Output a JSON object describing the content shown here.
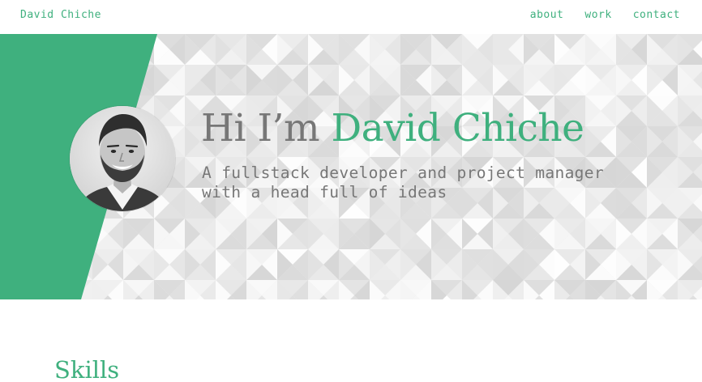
{
  "navbar": {
    "brand": "David Chiche",
    "links": [
      {
        "label": "about"
      },
      {
        "label": "work"
      },
      {
        "label": "contact"
      }
    ]
  },
  "hero": {
    "greeting": "Hi I’m",
    "name": "David Chiche",
    "subtitle_line1": "A fullstack developer and project manager",
    "subtitle_line2": "with a head full of ideas",
    "avatar_icon": "profile-photo"
  },
  "sections": {
    "skills_heading": "Skills"
  },
  "colors": {
    "accent": "#3fb07e",
    "text_gray": "#777777",
    "background": "#ffffff",
    "pattern_light": "#f4f4f4",
    "pattern_dark": "#d9d9d9"
  }
}
